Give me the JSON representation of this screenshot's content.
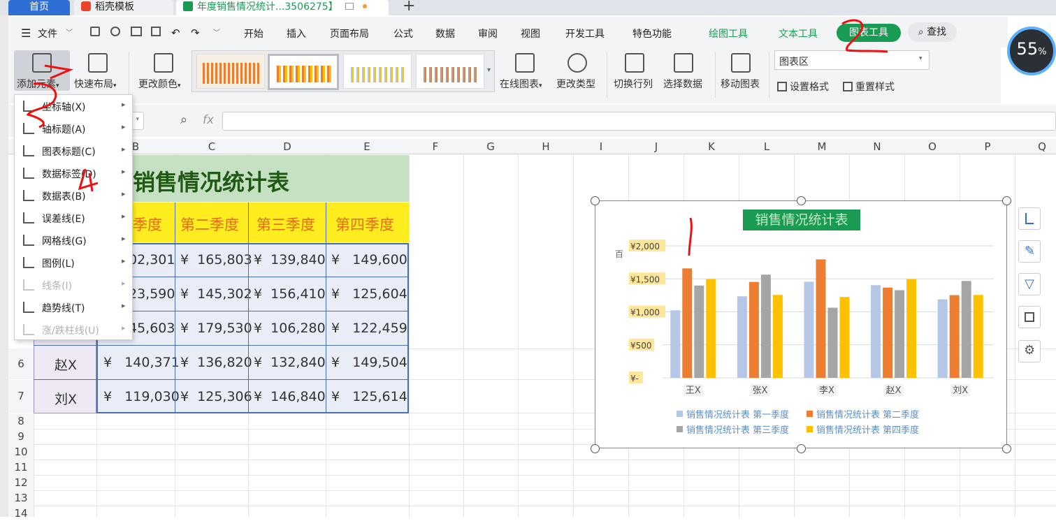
{
  "tabs": {
    "home": "首页",
    "template": "稻壳模板",
    "doc": "年度销售情况统计...3506275】",
    "add": "+"
  },
  "menubar": {
    "file": "文件",
    "items": [
      "开始",
      "插入",
      "页面布局",
      "公式",
      "数据",
      "审阅",
      "视图",
      "开发工具",
      "特色功能"
    ],
    "tools": [
      "绘图工具",
      "文本工具"
    ],
    "active_tool": "图表工具",
    "search": "查找"
  },
  "ribbon": {
    "add_element": "添加元素",
    "quick_layout": "快速布局",
    "change_color": "更改颜色",
    "online_chart": "在线图表",
    "change_type": "更改类型",
    "switch_row_col": "切换行列",
    "select_data": "选择数据",
    "move_chart": "移动图表",
    "chart_area_select": "图表区",
    "set_format": "设置格式",
    "reset_style": "重置样式"
  },
  "formula_bar": {
    "fx": "fx"
  },
  "gauge": {
    "value": "55",
    "unit": "%"
  },
  "columns": [
    "B",
    "C",
    "D",
    "E",
    "F",
    "G",
    "H",
    "I",
    "J",
    "K",
    "L",
    "M",
    "N",
    "O",
    "P",
    "Q"
  ],
  "rows": [
    "6",
    "7",
    "8",
    "9",
    "10",
    "11",
    "12",
    "13",
    "14"
  ],
  "dropdown": [
    {
      "label": "坐标轴(X)",
      "enabled": true
    },
    {
      "label": "轴标题(A)",
      "enabled": true
    },
    {
      "label": "图表标题(C)",
      "enabled": true
    },
    {
      "label": "数据标签(D)",
      "enabled": true
    },
    {
      "label": "数据表(B)",
      "enabled": true
    },
    {
      "label": "误差线(E)",
      "enabled": true
    },
    {
      "label": "网格线(G)",
      "enabled": true
    },
    {
      "label": "图例(L)",
      "enabled": true
    },
    {
      "label": "线条(I)",
      "enabled": false
    },
    {
      "label": "趋势线(T)",
      "enabled": true
    },
    {
      "label": "涨/跌柱线(U)",
      "enabled": false
    }
  ],
  "sheet": {
    "title": "销售情况统计表",
    "headers": [
      "季度",
      "第二季度",
      "第三季度",
      "第四季度"
    ],
    "rows": [
      {
        "name": "",
        "q1": "02,301",
        "q2": "¥  165,803",
        "q3": "¥  139,840",
        "q4": "¥   149,600"
      },
      {
        "name": "",
        "q1": "23,590",
        "q2": "¥  145,302",
        "q3": "¥  156,410",
        "q4": "¥   125,604"
      },
      {
        "name": "",
        "q1": "45,603",
        "q2": "¥  179,530",
        "q3": "¥  106,280",
        "q4": "¥   122,459"
      },
      {
        "name": "赵X",
        "q1": "¥   140,371",
        "q2": "¥  136,820",
        "q3": "¥  132,840",
        "q4": "¥   149,504"
      },
      {
        "name": "刘X",
        "q1": "¥   119,030",
        "q2": "¥  125,306",
        "q3": "¥  146,840",
        "q4": "¥   125,614"
      }
    ]
  },
  "chart_data": {
    "type": "bar",
    "title": "销售情况统计表",
    "ylabel": "百",
    "categories": [
      "王X",
      "张X",
      "李X",
      "赵X",
      "刘X"
    ],
    "yticks": [
      "¥2,000",
      "¥1,500",
      "¥1,000",
      "¥500",
      "¥-"
    ],
    "ylim": [
      0,
      2000
    ],
    "grid": true,
    "legend_position": "bottom",
    "series": [
      {
        "name": "销售情况统计表 第一季度",
        "color": "#b4c7e7",
        "values": [
          1023,
          1236,
          1456,
          1404,
          1190
        ]
      },
      {
        "name": "销售情况统计表 第二季度",
        "color": "#ed7d31",
        "values": [
          1658,
          1453,
          1795,
          1368,
          1253
        ]
      },
      {
        "name": "销售情况统计表 第三季度",
        "color": "#a5a5a5",
        "values": [
          1398,
          1564,
          1063,
          1328,
          1468
        ]
      },
      {
        "name": "销售情况统计表 第四季度",
        "color": "#ffc000",
        "values": [
          1496,
          1256,
          1225,
          1495,
          1256
        ]
      }
    ]
  },
  "annotations": [
    "2",
    "3",
    "4",
    "1"
  ]
}
